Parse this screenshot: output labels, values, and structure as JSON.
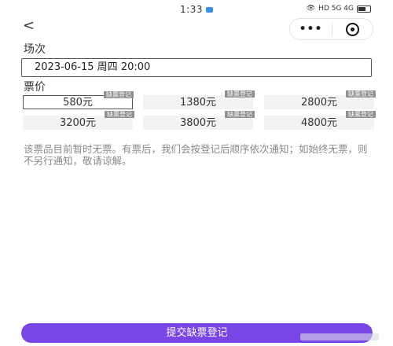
{
  "status": {
    "time": "1:33",
    "network": "HD 5G 4G"
  },
  "nav": {
    "back_glyph": "<",
    "more_glyph": "•••"
  },
  "session": {
    "label": "场次",
    "value": "2023-06-15 周四 20:00"
  },
  "price_section": {
    "label": "票价",
    "tag_text": "缺票登记",
    "prices": [
      {
        "value": "580元",
        "selected": true
      },
      {
        "value": "1380元",
        "selected": false
      },
      {
        "value": "2800元",
        "selected": false
      },
      {
        "value": "3200元",
        "selected": false
      },
      {
        "value": "3800元",
        "selected": false
      },
      {
        "value": "4800元",
        "selected": false
      }
    ]
  },
  "notice": "该票品目前暂时无票。有票后，我们会按登记后顺序依次通知；如始终无票，则不另行通知，敬请谅解。",
  "submit_label": "提交缺票登记",
  "colors": {
    "accent": "#7a45e6",
    "tag_bg": "#8f8f8f",
    "price_bg": "#f3f3f3"
  }
}
